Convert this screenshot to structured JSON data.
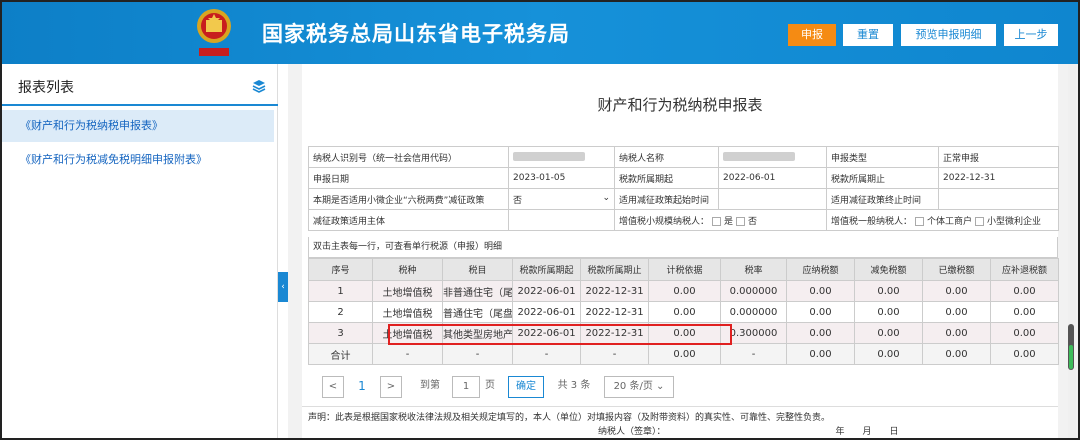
{
  "header": {
    "title": "国家税务总局山东省电子税务局",
    "buttons": {
      "submit": "申报",
      "reset": "重置",
      "preview": "预览申报明细",
      "back": "上一步"
    },
    "colors": {
      "bar": "#1a88d3",
      "submit": "#f58b13"
    }
  },
  "sidebar": {
    "title": "报表列表",
    "icon": "layers-icon",
    "items": [
      {
        "label": "《财产和行为税纳税申报表》"
      },
      {
        "label": "《财产和行为税减免税明细申报附表》"
      }
    ]
  },
  "form": {
    "title": "财产和行为税纳税申报表",
    "taxpayer_id_label": "纳税人识别号（统一社会信用代码）",
    "taxpayer_name_label": "纳税人名称",
    "decl_type_label": "申报类型",
    "decl_type_value": "正常申报",
    "decl_date_label": "申报日期",
    "decl_date_value": "2023-01-05",
    "period_start_label": "税款所属期起",
    "period_start_value": "2022-06-01",
    "period_end_label": "税款所属期止",
    "period_end_value": "2022-12-31",
    "six_tax_label": "本期是否适用小微企业“六税两费”减征政策",
    "six_tax_value": "否",
    "reduce_start_label": "适用减征政策起始时间",
    "reduce_end_label": "适用减征政策终止时间",
    "reduce_subject_label": "减征政策适用主体",
    "vat_small_label": "增值税小规模纳税人：",
    "yes": "是",
    "no": "否",
    "vat_general_label": "增值税一般纳税人：",
    "individual": "个体工商户",
    "micro": "小型微利企业",
    "detail_note": "双击主表每一行，可查看单行税源（申报）明细"
  },
  "grid": {
    "headers": [
      "序号",
      "税种",
      "税目",
      "税款所属期起",
      "税款所属期止",
      "计税依据",
      "税率",
      "应纳税额",
      "减免税额",
      "已缴税额",
      "应补退税额"
    ],
    "rows": [
      [
        "1",
        "土地增值税",
        "非普通住宅（尾",
        "2022-06-01",
        "2022-12-31",
        "0.00",
        "0.000000",
        "0.00",
        "0.00",
        "0.00",
        "0.00"
      ],
      [
        "2",
        "土地增值税",
        "普通住宅（尾盘",
        "2022-06-01",
        "2022-12-31",
        "0.00",
        "0.000000",
        "0.00",
        "0.00",
        "0.00",
        "0.00"
      ],
      [
        "3",
        "土地增值税",
        "其他类型房地产",
        "2022-06-01",
        "2022-12-31",
        "0.00",
        "0.300000",
        "0.00",
        "0.00",
        "0.00",
        "0.00"
      ]
    ],
    "total": [
      "合计",
      "-",
      "-",
      "-",
      "-",
      "0.00",
      "-",
      "0.00",
      "0.00",
      "0.00",
      "0.00"
    ]
  },
  "pager": {
    "prev": "<",
    "current": "1",
    "next": ">",
    "goto_label": "到第",
    "goto_value": "1",
    "page_unit": "页",
    "confirm": "确定",
    "total": "共 3 条",
    "page_size": "20 条/页"
  },
  "declaration": {
    "text": "声明：此表是根据国家税收法律法规及相关规定填写的，本人（单位）对填报内容（及附带资料）的真实性、可靠性、完整性负责。",
    "signer": "纳税人（签章）：",
    "date": "年　　月　　日"
  }
}
